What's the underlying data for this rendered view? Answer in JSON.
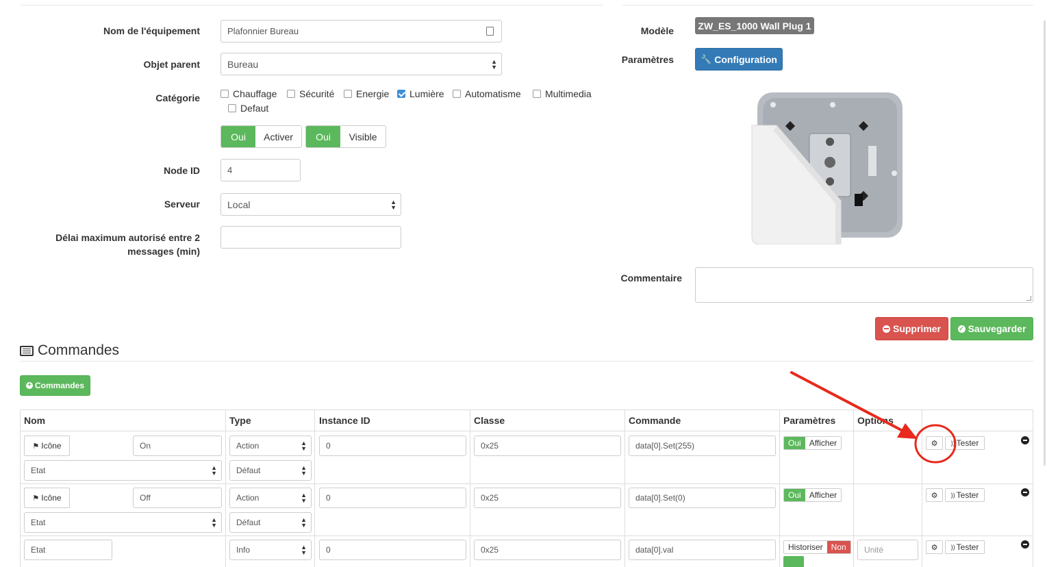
{
  "form": {
    "name_label": "Nom de l'équipement",
    "name_value": "Plafonnier Bureau",
    "parent_label": "Objet parent",
    "parent_value": "Bureau",
    "category_label": "Catégorie",
    "categories": [
      {
        "label": "Chauffage",
        "checked": false
      },
      {
        "label": "Sécurité",
        "checked": false
      },
      {
        "label": "Energie",
        "checked": false
      },
      {
        "label": "Lumière",
        "checked": true
      },
      {
        "label": "Automatisme",
        "checked": false
      },
      {
        "label": "Multimedia",
        "checked": false
      },
      {
        "label": "Defaut",
        "checked": false
      }
    ],
    "activer_on": "Oui",
    "activer_label": "Activer",
    "visible_on": "Oui",
    "visible_label": "Visible",
    "nodeid_label": "Node ID",
    "nodeid_value": "4",
    "server_label": "Serveur",
    "server_value": "Local",
    "delay_label_1": "Délai maximum autorisé entre 2",
    "delay_label_2": "messages (min)",
    "delay_value": ""
  },
  "right": {
    "model_label": "Modèle",
    "model_value": "ZW_ES_1000 Wall Plug 1",
    "params_label": "Paramètres",
    "config_button": "Configuration",
    "comment_label": "Commentaire",
    "comment_value": "",
    "delete_button": "Supprimer",
    "save_button": "Sauvegarder"
  },
  "commands": {
    "title": "Commandes",
    "add_button": "Commandes",
    "columns": [
      "Nom",
      "Type",
      "Instance ID",
      "Classe",
      "Commande",
      "Paramètres",
      "Options"
    ],
    "rows": [
      {
        "icon_btn": "Icône",
        "name": "On",
        "generic": "Etat",
        "type": "Action",
        "subtype": "Défaut",
        "instance": "0",
        "classe": "0x25",
        "commande": "data[0].Set(255)",
        "p_on": "Oui",
        "p_label": "Afficher",
        "test": "Tester"
      },
      {
        "icon_btn": "Icône",
        "name": "Off",
        "generic": "Etat",
        "type": "Action",
        "subtype": "Défaut",
        "instance": "0",
        "classe": "0x25",
        "commande": "data[0].Set(0)",
        "p_on": "Oui",
        "p_label": "Afficher",
        "test": "Tester"
      },
      {
        "name": "Etat",
        "type": "Info",
        "instance": "0",
        "classe": "0x25",
        "commande": "data[0].val",
        "historiser": "Historiser",
        "historiser_state": "Non",
        "unit_placeholder": "Unité",
        "test": "Tester"
      }
    ]
  },
  "colors": {
    "green": "#5cb85c",
    "blue": "#337ab7",
    "red": "#d9534f",
    "annotation": "#e8291c"
  }
}
